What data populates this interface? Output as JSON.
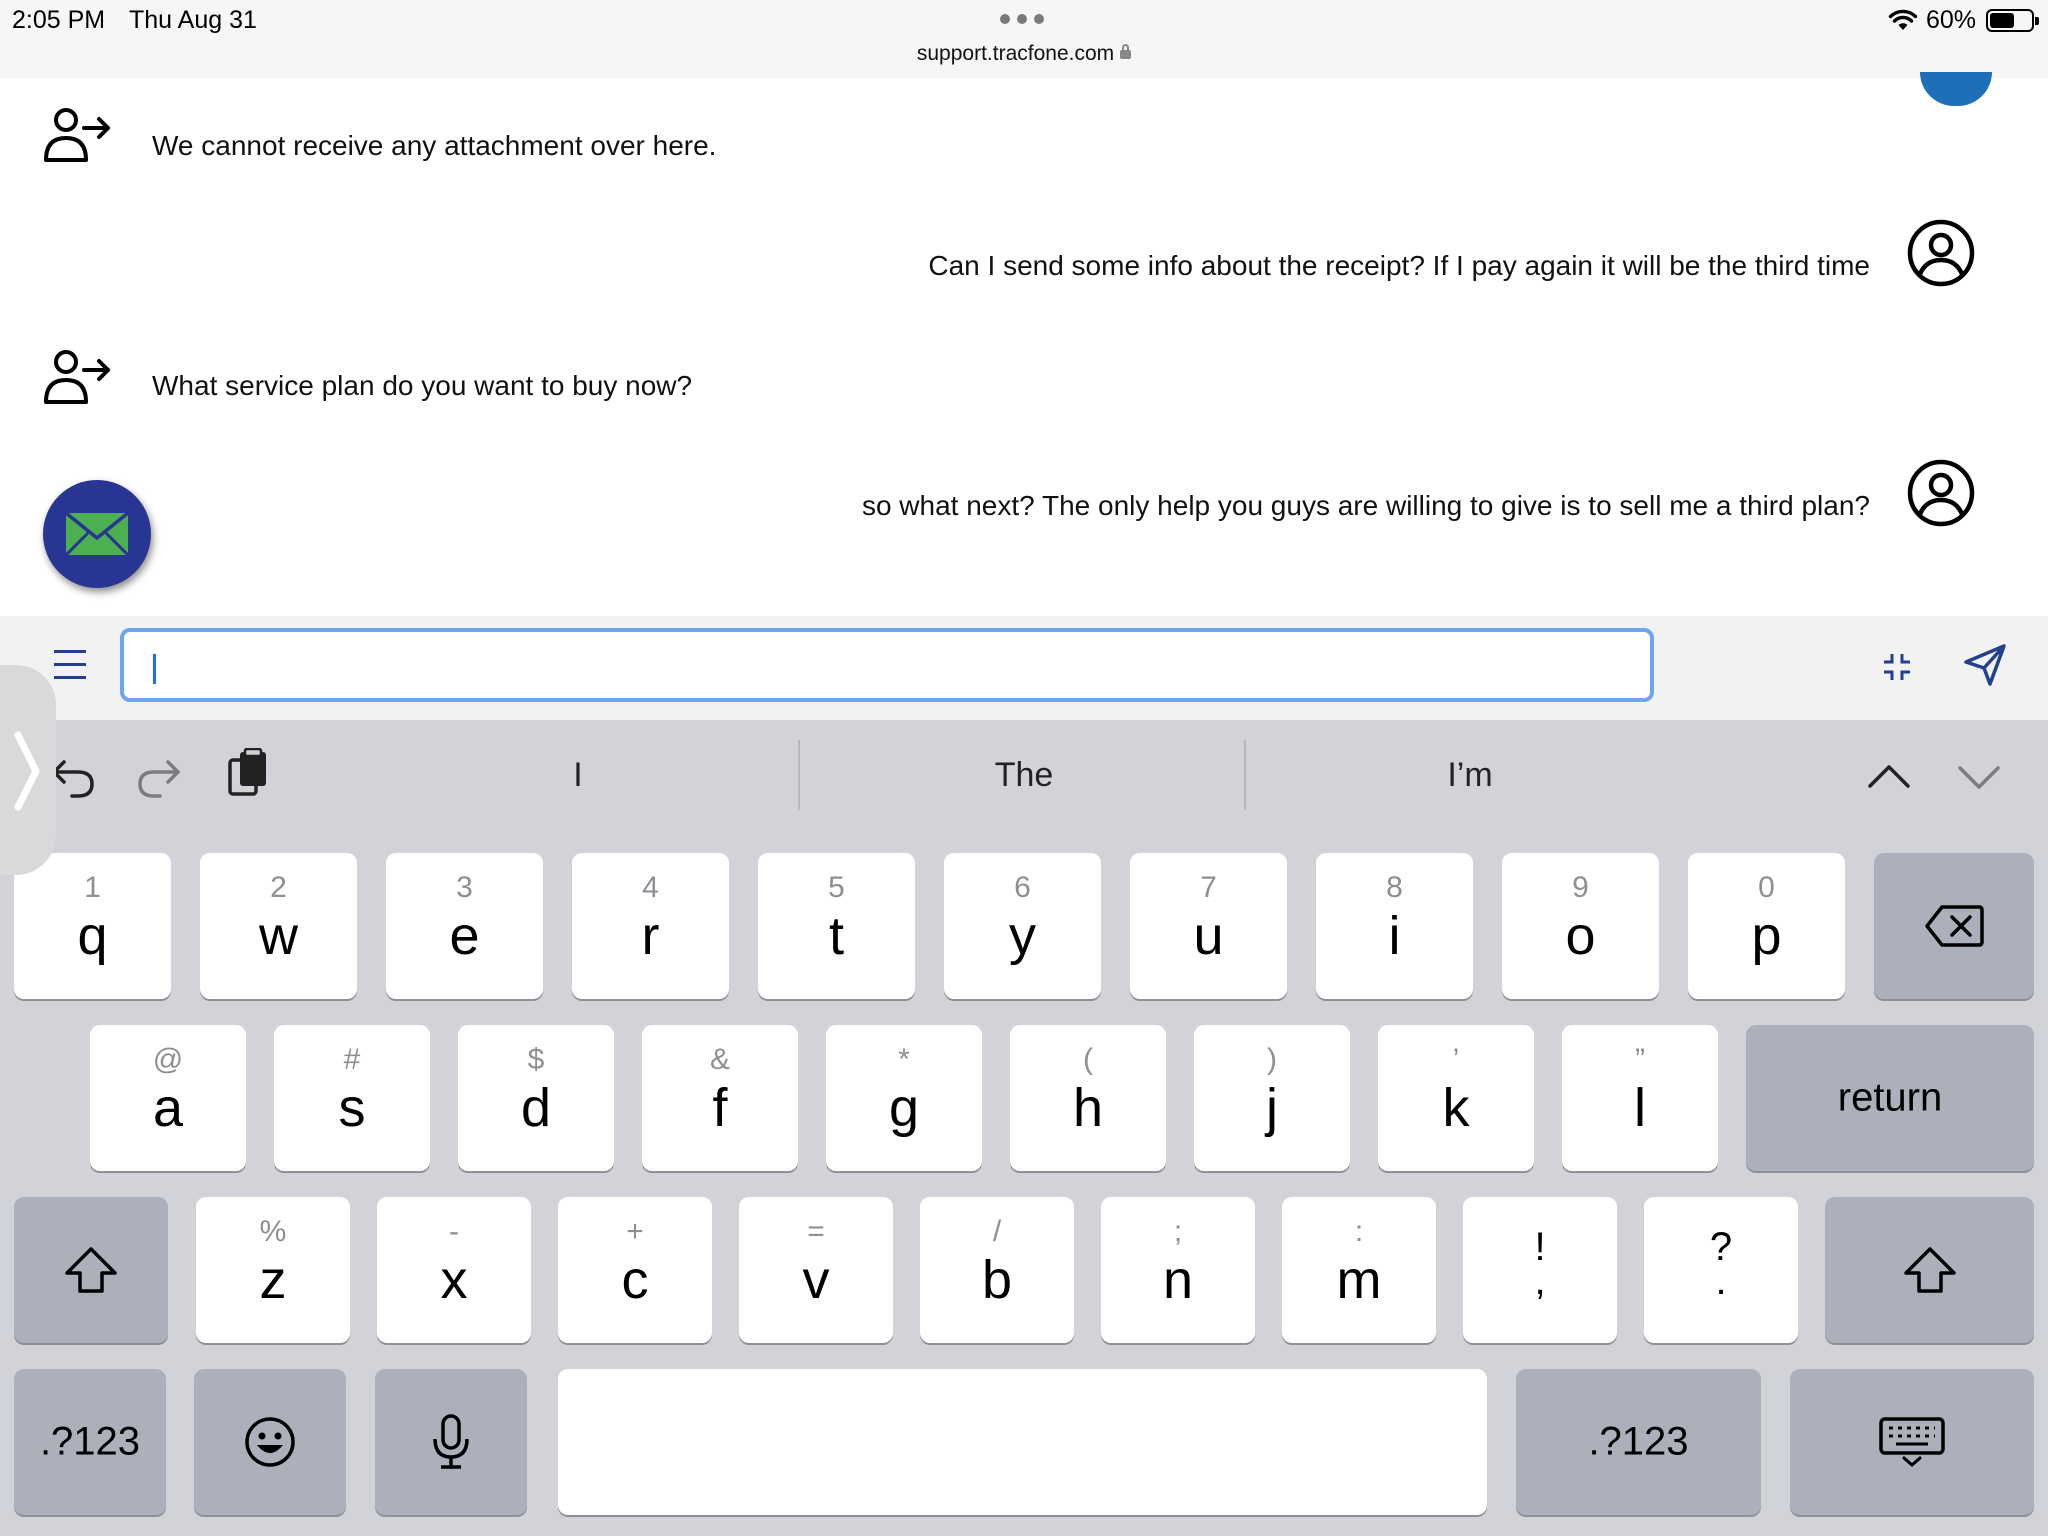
{
  "status_bar": {
    "time": "2:05 PM",
    "date": "Thu Aug 31",
    "url": "support.tracfone.com",
    "battery": "60%"
  },
  "chat": {
    "messages": [
      {
        "from": "agent",
        "text": "We cannot receive any attachment over here."
      },
      {
        "from": "user",
        "text": "Can I send some info about the receipt? If I pay again it will be the third time"
      },
      {
        "from": "agent",
        "text": "What service plan do you want to buy now?"
      },
      {
        "from": "user",
        "text": "so what next? The only help you guys are willing to give is to sell me a third plan?"
      }
    ]
  },
  "compose": {
    "input_value": ""
  },
  "keyboard": {
    "suggestions": [
      "I",
      "The",
      "I’m"
    ],
    "row1": [
      {
        "alt": "1",
        "main": "q"
      },
      {
        "alt": "2",
        "main": "w"
      },
      {
        "alt": "3",
        "main": "e"
      },
      {
        "alt": "4",
        "main": "r"
      },
      {
        "alt": "5",
        "main": "t"
      },
      {
        "alt": "6",
        "main": "y"
      },
      {
        "alt": "7",
        "main": "u"
      },
      {
        "alt": "8",
        "main": "i"
      },
      {
        "alt": "9",
        "main": "o"
      },
      {
        "alt": "0",
        "main": "p"
      }
    ],
    "row2": [
      {
        "alt": "@",
        "main": "a"
      },
      {
        "alt": "#",
        "main": "s"
      },
      {
        "alt": "$",
        "main": "d"
      },
      {
        "alt": "&",
        "main": "f"
      },
      {
        "alt": "*",
        "main": "g"
      },
      {
        "alt": "(",
        "main": "h"
      },
      {
        "alt": ")",
        "main": "j"
      },
      {
        "alt": "’",
        "main": "k"
      },
      {
        "alt": "”",
        "main": "l"
      }
    ],
    "row3": [
      {
        "alt": "%",
        "main": "z"
      },
      {
        "alt": "-",
        "main": "x"
      },
      {
        "alt": "+",
        "main": "c"
      },
      {
        "alt": "=",
        "main": "v"
      },
      {
        "alt": "/",
        "main": "b"
      },
      {
        "alt": ";",
        "main": "n"
      },
      {
        "alt": ":",
        "main": "m"
      }
    ],
    "punct": [
      {
        "top": "!",
        "bottom": ","
      },
      {
        "top": "?",
        "bottom": "."
      }
    ],
    "return_label": "return",
    "numbers_label": ".?123"
  },
  "icons": {
    "agent": "person-arrow-icon",
    "user": "user-circle-icon",
    "mail": "mail-icon",
    "menu": "hamburger-menu-icon",
    "send": "send-icon",
    "compress": "compress-icon"
  },
  "colors": {
    "input_border": "#6fa5f0",
    "mail_fab": "#283593",
    "mail_envelope": "#4caf50",
    "keyboard_bg": "#d1d3d9",
    "dark_key": "#abb0ba"
  }
}
